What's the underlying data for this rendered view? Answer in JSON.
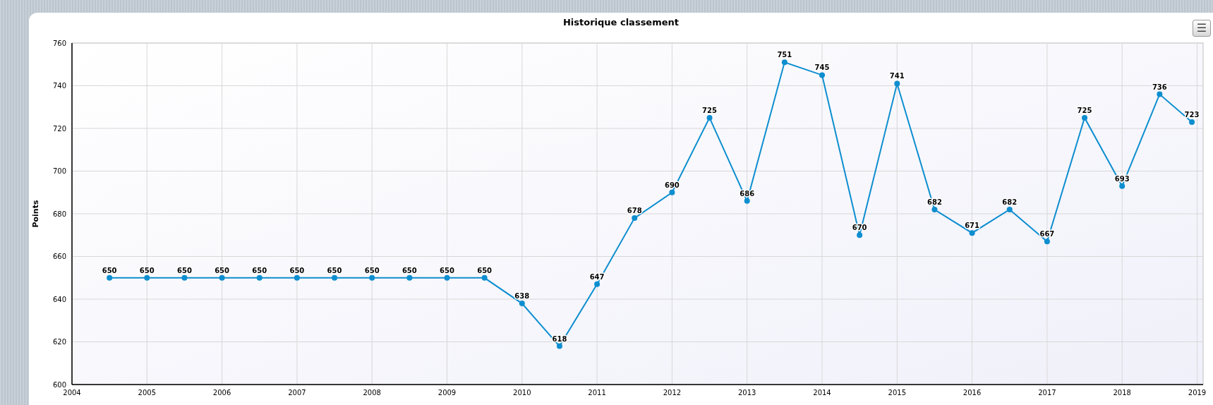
{
  "chart": {
    "menu_button": "☰",
    "chart_data": {
      "type": "line",
      "title": "Historique classement",
      "ylabel": "Points",
      "x": [
        2004.5,
        2005,
        2005.5,
        2006,
        2006.5,
        2007,
        2007.5,
        2008,
        2008.5,
        2009,
        2009.5,
        2010,
        2010.5,
        2011,
        2011.5,
        2012,
        2012.5,
        2013,
        2013.5,
        2014,
        2014.5,
        2015,
        2015.5,
        2016,
        2016.5,
        2017,
        2017.5,
        2018,
        2018.5,
        2018.93
      ],
      "grid": true,
      "series": [
        {
          "color": "#0d8ecf",
          "marker": true,
          "values": [
            650,
            650,
            650,
            650,
            650,
            650,
            650,
            650,
            650,
            650,
            650,
            638,
            618,
            647,
            678,
            690,
            725,
            686,
            751,
            745,
            670,
            741,
            682,
            671,
            682,
            667,
            725,
            693,
            736,
            723
          ]
        }
      ],
      "xlim": [
        2004,
        2019.08
      ],
      "ylim": [
        600,
        760
      ],
      "xticks": [
        2004,
        2005,
        2006,
        2007,
        2008,
        2009,
        2010,
        2011,
        2012,
        2013,
        2014,
        2015,
        2016,
        2017,
        2018,
        2019
      ],
      "yticks": [
        600,
        620,
        640,
        660,
        680,
        700,
        720,
        740,
        760
      ],
      "data_labels": true
    }
  }
}
